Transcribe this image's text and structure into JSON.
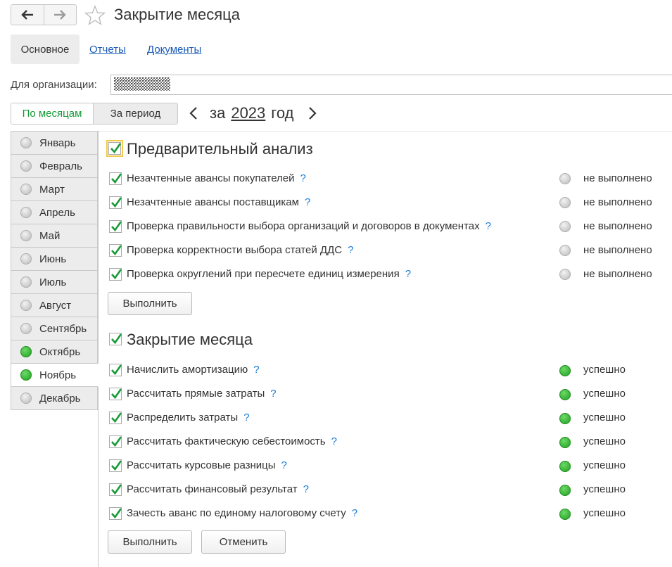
{
  "header": {
    "title": "Закрытие месяца",
    "back_icon": "arrow-left-icon",
    "forward_icon": "arrow-right-icon",
    "favorite_icon": "star-icon"
  },
  "tabs": [
    {
      "label": "Основное",
      "active": true
    },
    {
      "label": "Отчеты",
      "active": false
    },
    {
      "label": "Документы",
      "active": false
    }
  ],
  "organization": {
    "label": "Для организации:",
    "value_note": "obscured"
  },
  "mode": {
    "by_months": "По месяцам",
    "by_period": "За период"
  },
  "period": {
    "prefix": "за",
    "year": "2023",
    "suffix": "год"
  },
  "months": [
    {
      "label": "Январь",
      "status": "grey"
    },
    {
      "label": "Февраль",
      "status": "grey"
    },
    {
      "label": "Март",
      "status": "grey"
    },
    {
      "label": "Апрель",
      "status": "grey"
    },
    {
      "label": "Май",
      "status": "grey"
    },
    {
      "label": "Июнь",
      "status": "grey"
    },
    {
      "label": "Июль",
      "status": "grey"
    },
    {
      "label": "Август",
      "status": "grey"
    },
    {
      "label": "Сентябрь",
      "status": "grey"
    },
    {
      "label": "Октябрь",
      "status": "green"
    },
    {
      "label": "Ноябрь",
      "status": "green",
      "selected": true
    },
    {
      "label": "Декабрь",
      "status": "grey"
    }
  ],
  "preliminary": {
    "title": "Предварительный анализ",
    "checked": true,
    "items": [
      {
        "label": "Незачтенные авансы покупателей",
        "help": "?",
        "status": "не выполнено"
      },
      {
        "label": "Незачтенные авансы поставщикам",
        "help": "?",
        "status": "не выполнено"
      },
      {
        "label": "Проверка правильности выбора организаций и договоров в документах",
        "help": "?",
        "status": "не выполнено"
      },
      {
        "label": "Проверка корректности выбора статей ДДС",
        "help": "?",
        "status": "не выполнено"
      },
      {
        "label": "Проверка округлений при пересчете единиц измерения",
        "help": "?",
        "status": "не выполнено"
      }
    ],
    "run_label": "Выполнить"
  },
  "closing": {
    "title": "Закрытие месяца",
    "checked": true,
    "items": [
      {
        "label": "Начислить амортизацию",
        "help": "?",
        "status": "успешно"
      },
      {
        "label": "Рассчитать прямые затраты",
        "help": "?",
        "status": "успешно"
      },
      {
        "label": "Распределить затраты",
        "help": "?",
        "status": "успешно"
      },
      {
        "label": "Рассчитать фактическую себестоимость",
        "help": "?",
        "status": "успешно"
      },
      {
        "label": "Рассчитать курсовые разницы",
        "help": "?",
        "status": "успешно"
      },
      {
        "label": "Рассчитать финансовый результат",
        "help": "?",
        "status": "успешно"
      },
      {
        "label": "Зачесть аванс по единому налоговому счету",
        "help": "?",
        "status": "успешно"
      }
    ],
    "run_label": "Выполнить",
    "cancel_label": "Отменить"
  },
  "colors": {
    "success": "#3cb83a",
    "pending": "#c8c8c8",
    "link": "#1b5bb6",
    "help": "#1b7bd6",
    "active_mode": "#169b3a"
  }
}
